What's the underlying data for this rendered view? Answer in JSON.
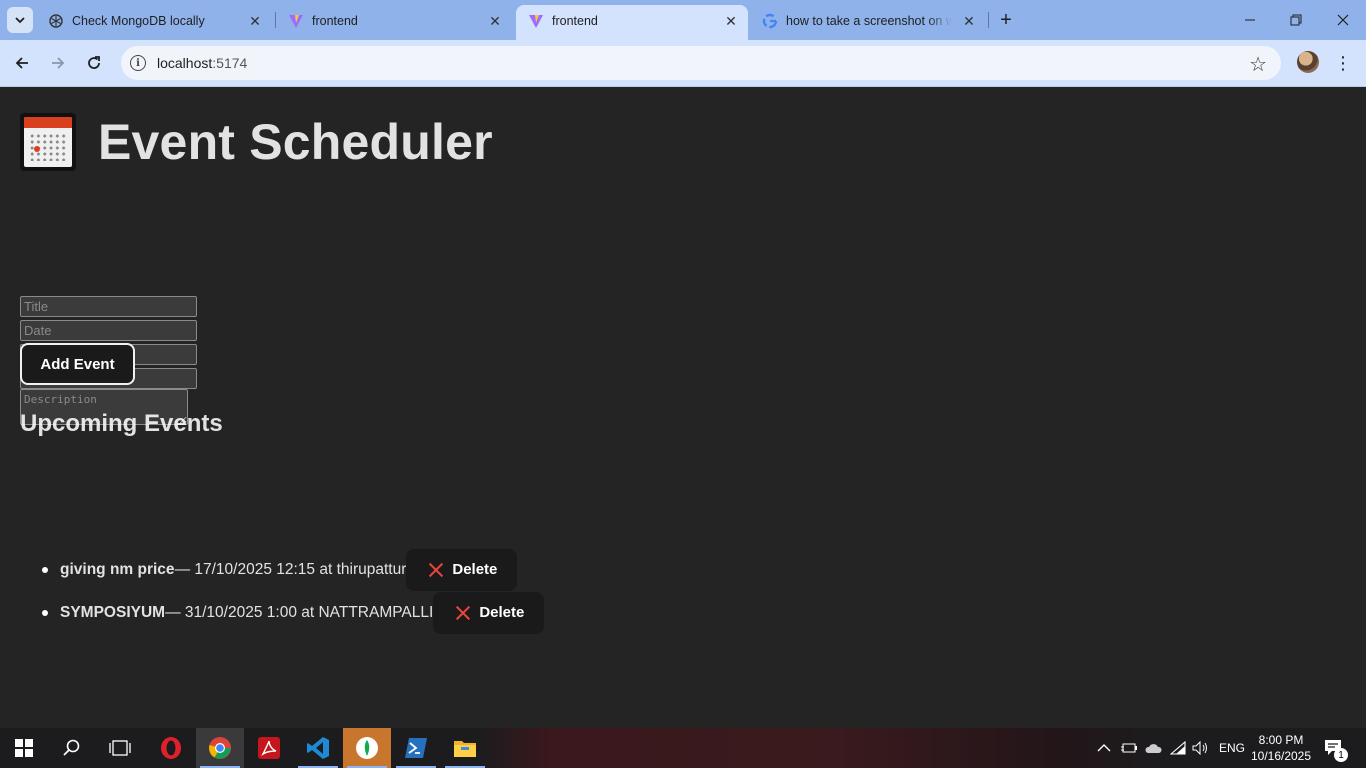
{
  "browser": {
    "tabs": [
      {
        "title": "Check MongoDB locally",
        "icon": "openai-icon",
        "active": false
      },
      {
        "title": "frontend",
        "icon": "vite-icon",
        "active": false
      },
      {
        "title": "frontend",
        "icon": "vite-icon",
        "active": true
      },
      {
        "title": "how to take a screenshot on wi",
        "icon": "google-icon",
        "active": false
      }
    ],
    "new_tab_label": "+",
    "url_host": "localhost",
    "url_port": ":5174"
  },
  "app": {
    "title": "Event Scheduler",
    "form": {
      "title_placeholder": "Title",
      "date_placeholder": "Date",
      "time_placeholder": "Time",
      "location_placeholder": "Location",
      "description_placeholder": "Description",
      "add_button_label": "Add Event"
    },
    "section_heading": "Upcoming Events",
    "events": [
      {
        "title": "giving nm price",
        "details": " — 17/10/2025 12:15 at thirupattur",
        "delete_label": "Delete"
      },
      {
        "title": "SYMPOSIYUM",
        "details": " — 31/10/2025 1:00 at NATTRAMPALLI",
        "delete_label": "Delete"
      }
    ]
  },
  "taskbar": {
    "apps": [
      "start-icon",
      "search-icon",
      "task-view-icon",
      "opera-icon",
      "chrome-icon",
      "acrobat-icon",
      "vscode-icon",
      "mongodb-compass-icon",
      "powershell-icon",
      "file-explorer-icon"
    ],
    "language": "ENG",
    "time": "8:00 PM",
    "date": "10/16/2025",
    "notification_count": "1"
  }
}
